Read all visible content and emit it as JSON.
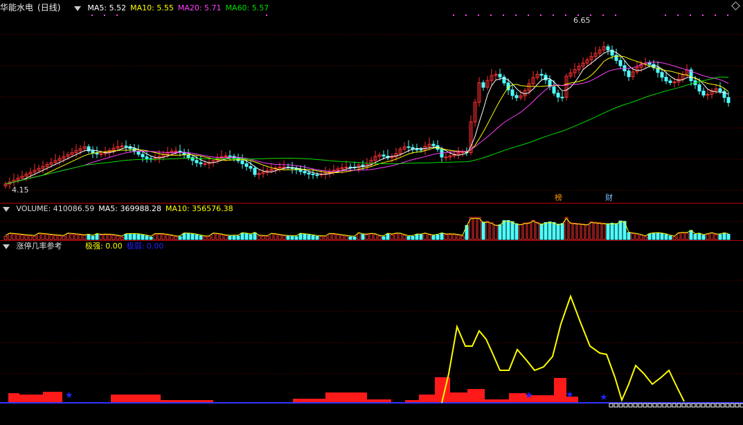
{
  "stock": {
    "name": "华能水电",
    "period": "(日线)"
  },
  "main_indicators": [
    {
      "label": "MA5: 5.52",
      "color": "#ffffff"
    },
    {
      "label": "MA10: 5.55",
      "color": "#ffff00"
    },
    {
      "label": "MA20: 5.71",
      "color": "#ff40ff"
    },
    {
      "label": "MA60: 5.57",
      "color": "#00e000"
    }
  ],
  "price_marks": {
    "high": "6.65",
    "low": "4.15"
  },
  "event_tags": [
    {
      "label": "榜",
      "color": "#ff9900"
    },
    {
      "label": "财",
      "color": "#80c0ff"
    }
  ],
  "volume_indicators": [
    {
      "label": "VOLUME: 410086.59",
      "color": "#dddddd"
    },
    {
      "label": "MA5: 369988.28",
      "color": "#ffffff"
    },
    {
      "label": "MA10: 356576.38",
      "color": "#ffff00"
    }
  ],
  "sub_panel": {
    "name": "涨停几率参考"
  },
  "sub_indicators": [
    {
      "label": "极强: 0.00",
      "color": "#ffff00"
    },
    {
      "label": "极弱: 0.00",
      "color": "#2222ff"
    }
  ],
  "chart_data": {
    "type": "candlestick",
    "price_range": [
      4.1,
      6.8
    ],
    "price_labels": {
      "max": 6.65,
      "min": 4.15
    },
    "colors": {
      "up": "#ff3030",
      "down": "#50ffff",
      "ma5": "#ffffff",
      "ma10": "#ffff00",
      "ma20": "#ff40ff",
      "ma60": "#00e000"
    }
  }
}
